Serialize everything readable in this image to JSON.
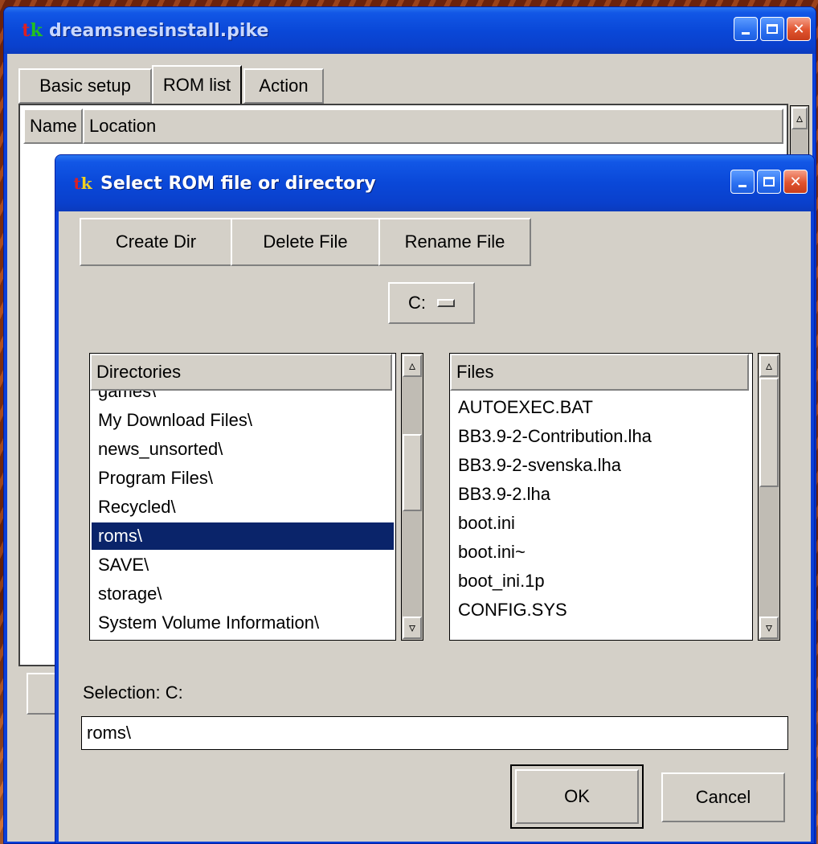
{
  "background_window": {
    "title": "dreamsnesinstall.pike",
    "tabs": [
      {
        "label": "Basic setup",
        "selected": false
      },
      {
        "label": "ROM list",
        "selected": true
      },
      {
        "label": "Action",
        "selected": false
      }
    ],
    "columns": [
      "Name",
      "Location"
    ]
  },
  "dialog": {
    "title": "Select ROM file or directory",
    "toolbar": {
      "create_dir": "Create Dir",
      "delete_file": "Delete File",
      "rename_file": "Rename File"
    },
    "drive_selector": {
      "value": "C:"
    },
    "directories": {
      "header": "Directories",
      "items": [
        "games\\",
        "My Download Files\\",
        "news_unsorted\\",
        "Program Files\\",
        "Recycled\\",
        "roms\\",
        "SAVE\\",
        "storage\\",
        "System Volume Information\\"
      ],
      "selected": "roms\\"
    },
    "files": {
      "header": "Files",
      "items": [
        "AUTOEXEC.BAT",
        "BB3.9-2-Contribution.lha",
        "BB3.9-2-svenska.lha",
        "BB3.9-2.lha",
        "boot.ini",
        "boot.ini~",
        "boot_ini.1p",
        "CONFIG.SYS"
      ]
    },
    "selection_label": "Selection: C:",
    "selection_value": "roms\\",
    "ok": "OK",
    "cancel": "Cancel"
  },
  "colors": {
    "titlebar": "#0a48d8",
    "selected_row": "#0a246a",
    "window_bg": "#d4d0c8",
    "close_button": "#e0532e"
  },
  "icons": [
    "tk-app-icon",
    "minimize-icon",
    "maximize-icon",
    "close-icon",
    "scroll-up-icon",
    "scroll-down-icon",
    "dropdown-indicator-icon"
  ]
}
